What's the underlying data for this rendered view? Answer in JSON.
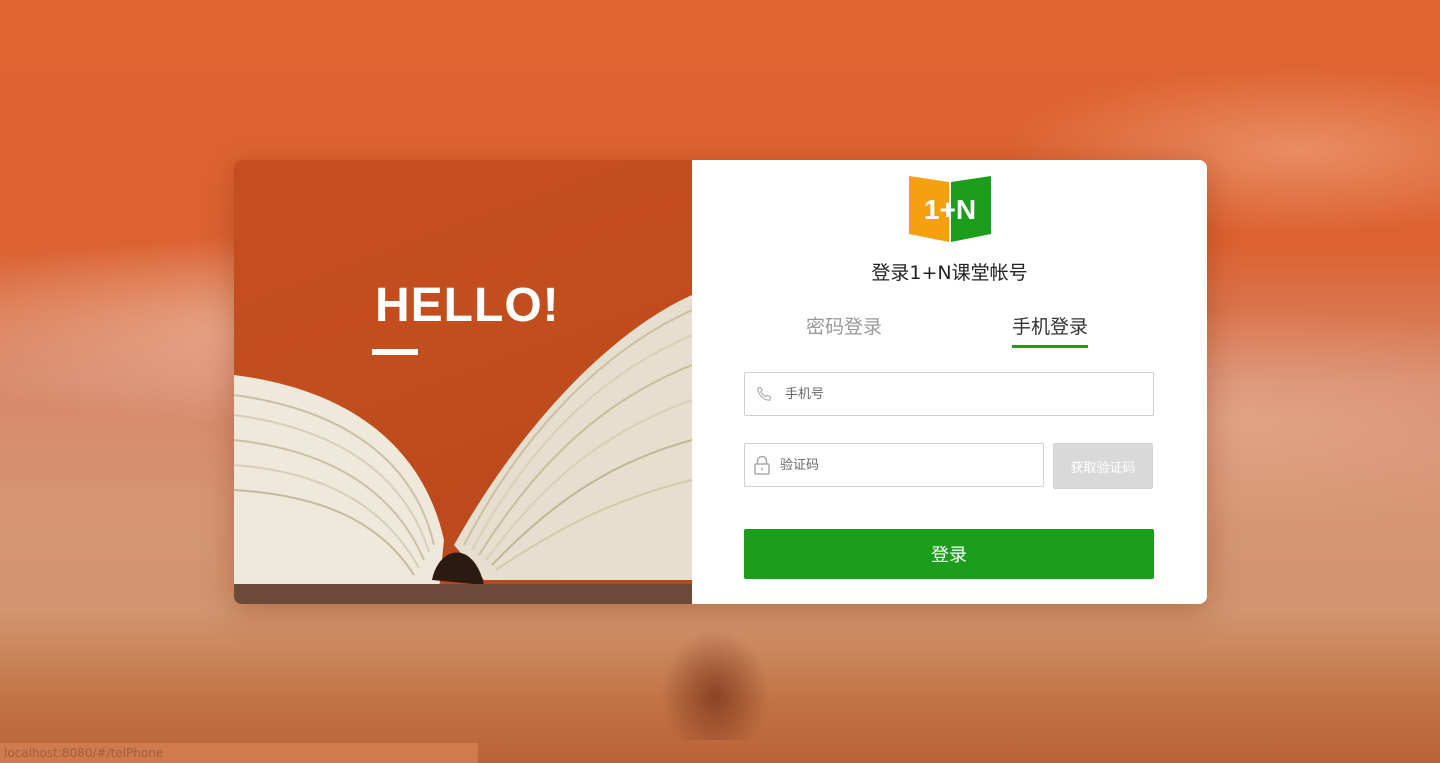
{
  "status_bar": {
    "url": "localhost:8080/#/telPhone"
  },
  "hero": {
    "greeting": "HELLO!"
  },
  "logo": {
    "text": "1+N",
    "colors": {
      "left_page": "#f5a00e",
      "right_page": "#1a9e1c"
    }
  },
  "login": {
    "title": "登录1+N课堂帐号",
    "tabs": [
      {
        "label": "密码登录",
        "active": false
      },
      {
        "label": "手机登录",
        "active": true
      }
    ],
    "phone_field": {
      "placeholder": "手机号",
      "value": "",
      "icon": "phone-icon"
    },
    "code_field": {
      "placeholder": "验证码",
      "value": "",
      "icon": "lock-icon"
    },
    "get_code_label": "获取验证码",
    "submit_label": "登录"
  },
  "colors": {
    "accent": "#1a9e1c",
    "hero_bg": "#c54e1f",
    "page_bg": "#dc6231"
  }
}
